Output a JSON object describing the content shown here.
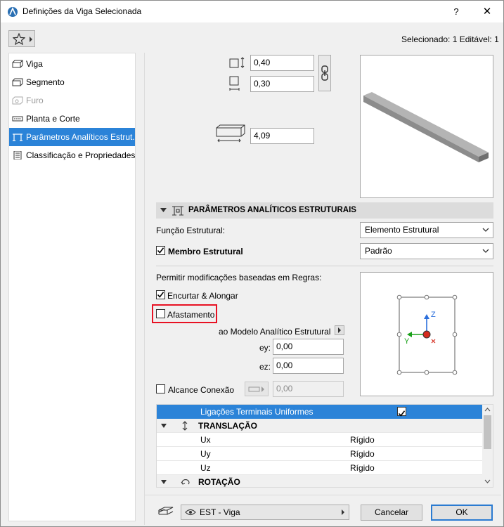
{
  "window": {
    "title": "Definições da Viga Selecionada",
    "help_label": "?",
    "close_label": "✕"
  },
  "header": {
    "selection_status": "Selecionado: 1 Editável: 1"
  },
  "sidebar": {
    "items": [
      {
        "label": "Viga",
        "icon": "beam-icon",
        "state": "normal"
      },
      {
        "label": "Segmento",
        "icon": "segment-icon",
        "state": "normal"
      },
      {
        "label": "Furo",
        "icon": "hole-icon",
        "state": "disabled"
      },
      {
        "label": "Planta e Corte",
        "icon": "plan-section-icon",
        "state": "normal"
      },
      {
        "label": "Parâmetros Analíticos Estrut...",
        "icon": "structural-analytical-icon",
        "state": "selected"
      },
      {
        "label": "Classificação e Propriedades",
        "icon": "classification-icon",
        "state": "normal"
      }
    ]
  },
  "geometry": {
    "height_value": "0,40",
    "width_value": "0,30",
    "length_value": "4,09"
  },
  "section": {
    "title": "PARÂMETROS ANALÍTICOS ESTRUTURAIS"
  },
  "structural_function": {
    "label": "Função Estrutural:",
    "value": "Elemento Estrutural"
  },
  "structural_member": {
    "label": "Membro Estrutural",
    "checked": true,
    "value": "Padrão"
  },
  "rules": {
    "label": "Permitir modificações baseadas em Regras:",
    "shorten_extend_label": "Encurtar & Alongar",
    "shorten_extend_checked": true,
    "offset_label": "Afastamento",
    "offset_checked": false,
    "offset_target_label": "ao Modelo Analítico Estrutural",
    "ey_label": "ey:",
    "ey_value": "0,00",
    "ez_label": "ez:",
    "ez_value": "0,00",
    "connection_reach_label": "Alcance Conexão",
    "connection_reach_checked": false,
    "connection_reach_value": "0,00"
  },
  "axis_preview": {
    "z_label": "Z",
    "y_label": "Y",
    "x_label": "X"
  },
  "end_releases": {
    "header_label": "Ligações Terminais Uniformes",
    "header_checked": true,
    "translation_label": "TRANSLAÇÃO",
    "rows": [
      {
        "name": "Ux",
        "value": "Rígido"
      },
      {
        "name": "Uy",
        "value": "Rígido"
      },
      {
        "name": "Uz",
        "value": "Rígido"
      }
    ],
    "rotation_label": "ROTAÇÃO"
  },
  "footer": {
    "layer_value": "EST - Viga",
    "cancel_label": "Cancelar",
    "ok_label": "OK"
  },
  "colors": {
    "accent": "#2b83d8",
    "beam_gray": "#8c8c8c",
    "highlight_red": "#e81123"
  }
}
